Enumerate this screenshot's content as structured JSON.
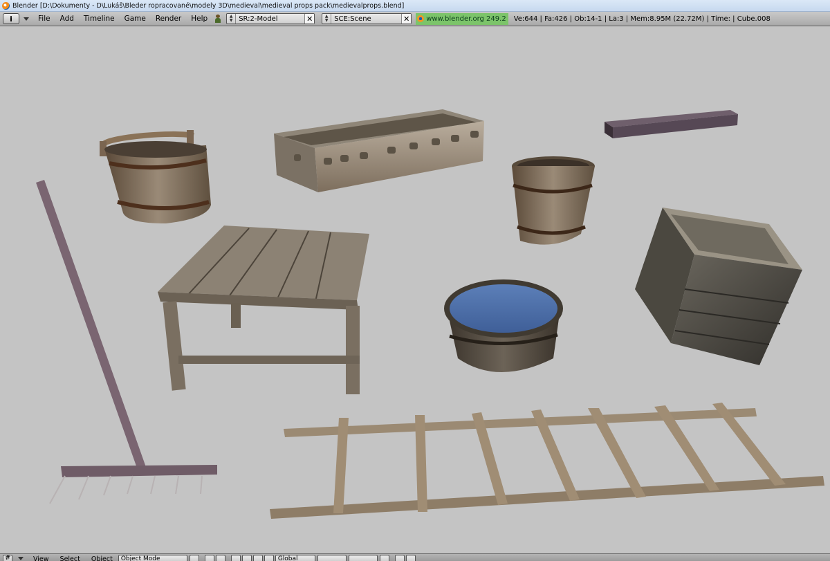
{
  "window": {
    "title": "Blender [D:\\Dokumenty - D\\Lukáš\\Bleder ropracované\\modely 3D\\medieval\\medieval props pack\\medievalprops.blend]"
  },
  "info_header": {
    "editor_type_icon": "info-icon",
    "menus": [
      "File",
      "Add",
      "Timeline",
      "Game",
      "Render",
      "Help"
    ],
    "screen_field": "SR:2-Model",
    "scene_field": "SCE:Scene",
    "website": "www.blender.org 249.2",
    "stats": "Ve:644 | Fa:426 | Ob:14-1 | La:3  | Mem:8.95M (22.72M)  | Time: | Cube.008"
  },
  "viewport": {
    "background_color": "#c4c4c4",
    "objects": [
      "bucket-with-handle",
      "wooden-trough",
      "wooden-plank",
      "small-barrel",
      "wooden-rake",
      "wooden-table",
      "water-tub",
      "wooden-crate",
      "wooden-ladder"
    ]
  },
  "view3d_header": {
    "editor_type_icon": "grid-icon",
    "menus": [
      "View",
      "Select",
      "Object"
    ],
    "mode": "Object Mode",
    "orientation": "Global"
  }
}
